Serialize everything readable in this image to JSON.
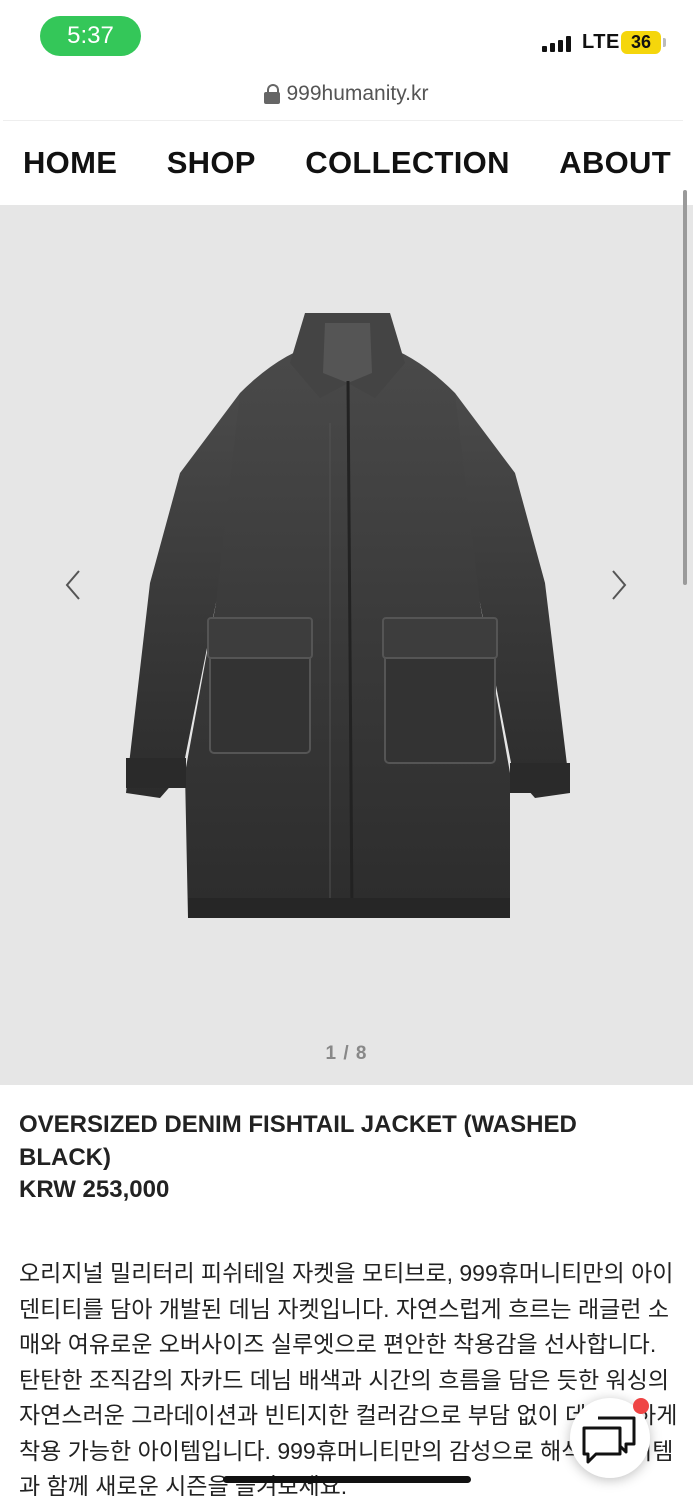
{
  "status_bar": {
    "time": "5:37",
    "network": "LTE",
    "battery": "36",
    "time_pill_color": "#34c759",
    "battery_color": "#f5d60c"
  },
  "browser": {
    "url": "999humanity.kr",
    "lock_icon": "lock-icon"
  },
  "nav": {
    "items": [
      "HOME",
      "SHOP",
      "COLLECTION",
      "ABOUT"
    ]
  },
  "gallery": {
    "counter": "1 / 8",
    "prev_icon": "chevron-left-icon",
    "next_icon": "chevron-right-icon",
    "background": "#e6e6e6"
  },
  "product": {
    "title": "OVERSIZED DENIM FISHTAIL JACKET (WASHED BLACK)",
    "price": "KRW 253,000",
    "description": "오리지널 밀리터리 피쉬테일 자켓을 모티브로, 999휴머니티만의 아이덴티티를 담아 개발된 데님 자켓입니다. 자연스럽게 흐르는 래글런 소매와 여유로운 오버사이즈 실루엣으로 편안한 착용감을 선사합니다. 탄탄한 조직감의 자카드 데님 배색과 시간의 흐름을 담은 듯한 워싱의 자연스러운 그라데이션과 빈티지한 컬러감으로 부담 없이 데일리 하게 착용 가능한 아이템입니다. 999휴머니티만의 감성으로 해석한 아이템과 함께 새로운 시즌을 즐겨보세요."
  },
  "chat": {
    "icon": "chat-bubbles-icon",
    "badge_color": "#ef4444"
  }
}
